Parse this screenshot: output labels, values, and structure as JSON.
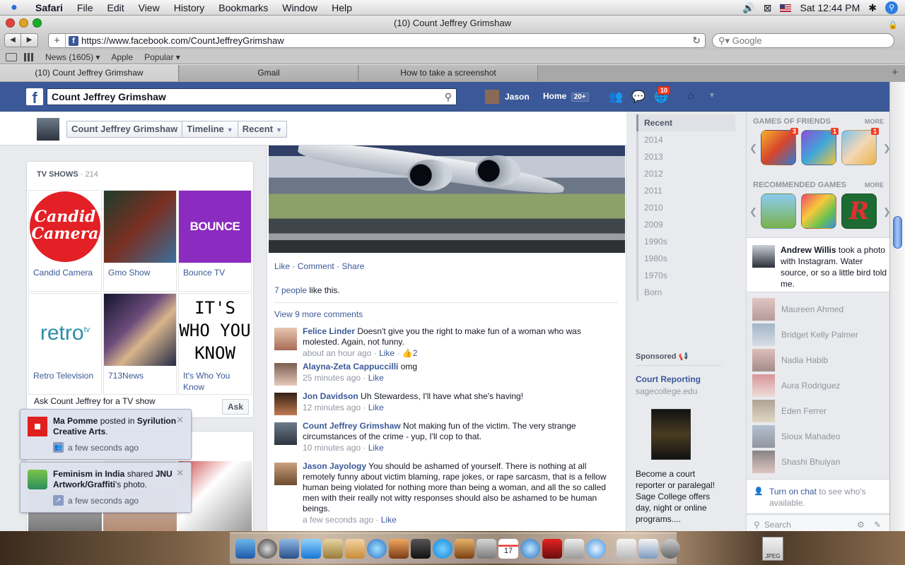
{
  "menubar": {
    "app_name": "Safari",
    "items": [
      "File",
      "Edit",
      "View",
      "History",
      "Bookmarks",
      "Window",
      "Help"
    ],
    "clock": "Sat 12:44 PM"
  },
  "window": {
    "title": "(10) Count Jeffrey Grimshaw",
    "url": "https://www.facebook.com/CountJeffreyGrimshaw",
    "search_placeholder": "Google"
  },
  "bookmarks": [
    "News (1605) ▾",
    "Apple",
    "Popular ▾"
  ],
  "tabs": [
    "(10) Count Jeffrey Grimshaw",
    "Gmail",
    "How to take a screenshot"
  ],
  "fb": {
    "search_value": "Count Jeffrey Grimshaw",
    "user": "Jason",
    "home": "Home",
    "home_count": "20+",
    "notif_count": "10"
  },
  "sticky": {
    "crumbs": [
      "Count Jeffrey Grimshaw",
      "Timeline",
      "Recent"
    ]
  },
  "tv_shows": {
    "heading": "TV SHOWS",
    "count": "· 214",
    "items": [
      "Candid Camera",
      "Gmo Show",
      "Bounce TV",
      "Retro Television",
      "713News",
      "It's Who You Know"
    ],
    "logos": {
      "candid": "Candid Camera",
      "bounce": "BOUNCE",
      "retro": "retro",
      "retro_tv": "tv",
      "iwyk": "IT'S WHO YOU KNOW"
    },
    "ask_text": "Ask Count Jeffrey for a TV show",
    "ask_button": "Ask"
  },
  "post": {
    "actions": [
      "Like",
      "Comment",
      "Share"
    ],
    "likes_link": "7 people",
    "likes_rest": " like this.",
    "more_comments": "View 9 more comments",
    "comments": [
      {
        "name": "Felice Linder",
        "text": "Doesn't give you the right to make fun of a woman who was molested. Again, not funny.",
        "time": "about an hour ago",
        "like": "Like",
        "likes": "2"
      },
      {
        "name": "Alayna-Zeta Cappuccilli",
        "text": "omg",
        "time": "25 minutes ago",
        "like": "Like"
      },
      {
        "name": "Jon Davidson",
        "text": "Uh Stewardess, I'll have what she's having!",
        "time": "12 minutes ago",
        "like": "Like"
      },
      {
        "name": "Count Jeffrey Grimshaw",
        "text": "Not making fun of the victim. The very strange circumstances of the crime - yup, I'll cop to that.",
        "time": "10 minutes ago",
        "like": "Like"
      },
      {
        "name": "Jason Jayology",
        "text": "You should be ashamed of yourself. There is nothing at all remotely funny about victim blaming, rape jokes, or rape sarcasm, that is a fellow human being violated for nothing more than being a woman, and all the so called men with their really not witty responses should also be ashamed to be human beings.",
        "time": "a few seconds ago",
        "like": "Like"
      }
    ]
  },
  "years": [
    "Recent",
    "2014",
    "2013",
    "2012",
    "2011",
    "2010",
    "2009",
    "1990s",
    "1980s",
    "1970s",
    "Born"
  ],
  "sponsored": {
    "heading": "Sponsored",
    "title": "Court Reporting",
    "url": "sagecollege.edu",
    "text": "Become a court reporter or paralegal! Sage College offers day, night or online programs...."
  },
  "right": {
    "games_friends": "GAMES OF FRIENDS",
    "more": "MORE",
    "recommended": "RECOMMENDED GAMES",
    "game_badges": [
      "3",
      "1",
      "1"
    ],
    "news": {
      "name": "Andrew Willis",
      "text": " took a photo with Instagram. Water source, or so a little bird told me."
    },
    "friends": [
      "Maureen Ahmed",
      "Bridget Kelly Palmer",
      "Nadia Habib",
      "Aura Rodriguez",
      "Eden Ferrer",
      "Sioux Mahadeo",
      "Shashi Bhuiyan"
    ],
    "chat_link": "Turn on chat",
    "chat_rest": " to see who's available.",
    "chat_search": "Search"
  },
  "notifications": [
    {
      "actor": "Ma Pomme",
      "verb": " posted in ",
      "target": "Syrilution Creative Arts",
      "tail": ".",
      "time": "a few seconds ago"
    },
    {
      "actor": "Feminism in India",
      "verb": " shared ",
      "target": "JNU Artwork/Graffiti",
      "tail": "'s photo.",
      "time": "a few seconds ago"
    }
  ],
  "dock": {
    "jpeg_label": "JPEG"
  }
}
